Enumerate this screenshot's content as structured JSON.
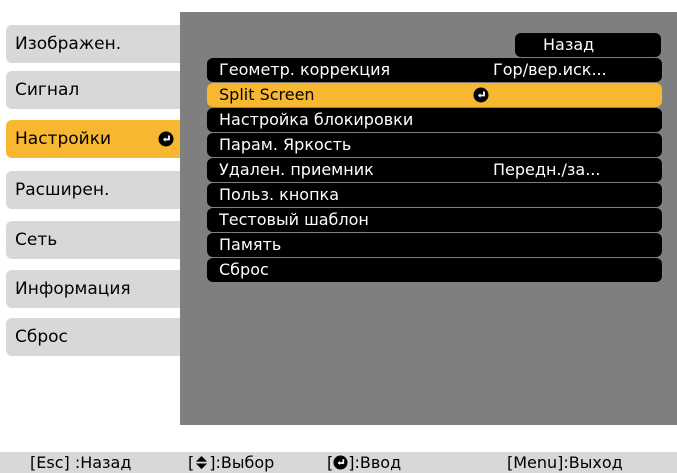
{
  "sidebar": {
    "items": [
      {
        "label": "Изображен."
      },
      {
        "label": "Сигнал"
      },
      {
        "label": "Настройки"
      },
      {
        "label": "Расширен."
      },
      {
        "label": "Сеть"
      },
      {
        "label": "Информация"
      },
      {
        "label": "Сброс"
      }
    ],
    "selected_index": 2
  },
  "panel": {
    "back_label": "Назад",
    "rows": [
      {
        "label": "Геометр. коррекция",
        "value": "Гор/вер.иск..."
      },
      {
        "label": "Split Screen",
        "value": ""
      },
      {
        "label": "Настройка блокировки",
        "value": ""
      },
      {
        "label": "Парам. Яркость",
        "value": ""
      },
      {
        "label": "Удален. приемник",
        "value": "Передн./за..."
      },
      {
        "label": "Польз. кнопка",
        "value": ""
      },
      {
        "label": "Тестовый шаблон",
        "value": ""
      },
      {
        "label": "Память",
        "value": ""
      },
      {
        "label": "Сброс",
        "value": ""
      }
    ],
    "selected_index": 1
  },
  "footer": {
    "esc_pre": "[Esc] :Назад",
    "select_pre": "[",
    "select_post": "]:Выбор",
    "enter_pre": "[",
    "enter_post": "]:Ввод",
    "menu": "[Menu]:Выход"
  },
  "icons": {
    "enter": "enter-icon",
    "updown": "updown-arrow-icon"
  },
  "colors": {
    "highlight": "#f7b730",
    "panel_bg": "#7f7f7f",
    "tab_bg": "#d8d8d8",
    "row_bg": "#000000"
  }
}
